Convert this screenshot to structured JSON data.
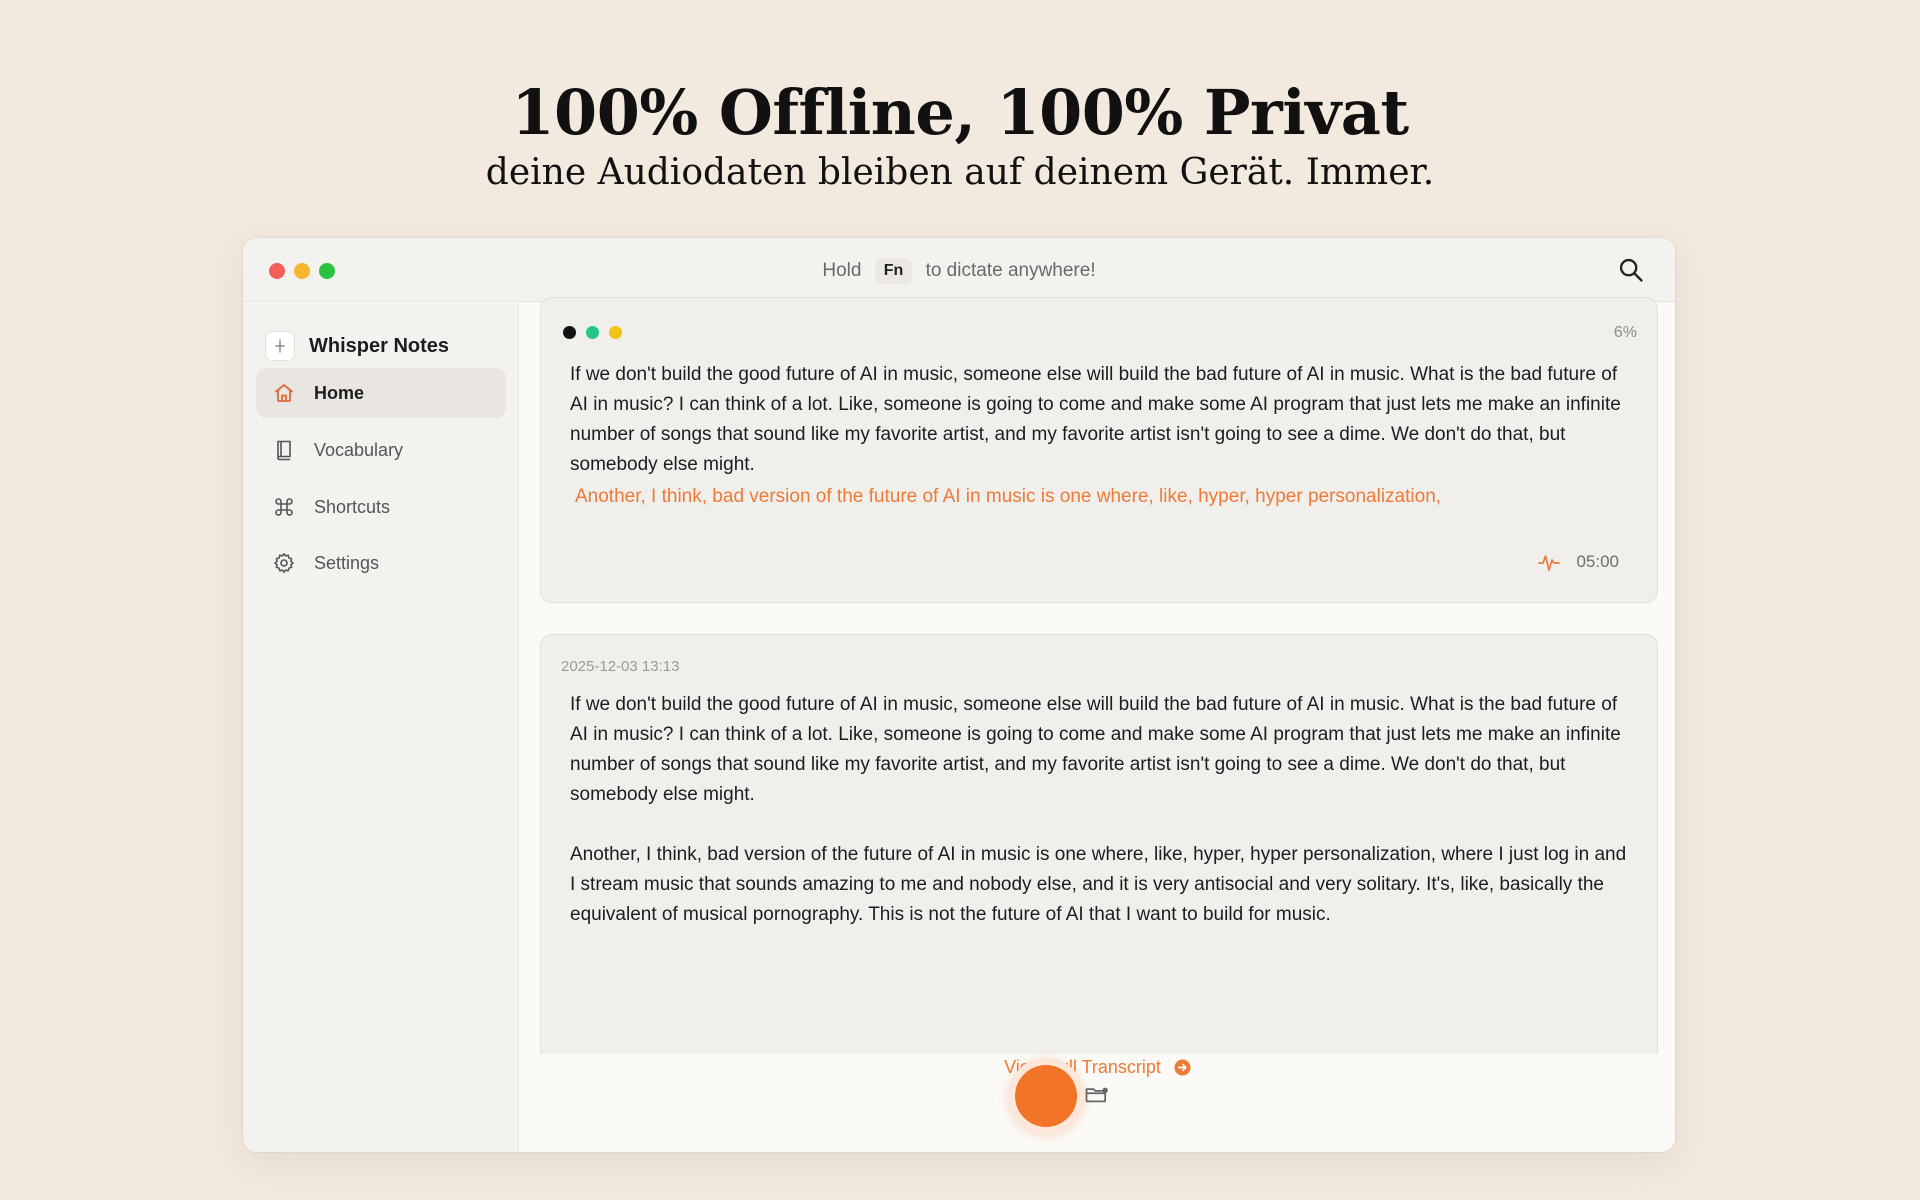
{
  "hero": {
    "title": "100% Offline, 100% Privat",
    "subtitle": "deine Audiodaten bleiben auf deinem Gerät. Immer."
  },
  "titlebar": {
    "hint_prefix": "Hold",
    "hint_key": "Fn",
    "hint_suffix": "to dictate anywhere!",
    "icons": {
      "search": "search-icon"
    }
  },
  "sidebar": {
    "app_name": "Whisper Notes",
    "items": [
      {
        "label": "Home",
        "icon": "home-icon",
        "active": true
      },
      {
        "label": "Vocabulary",
        "icon": "book-icon",
        "active": false
      },
      {
        "label": "Shortcuts",
        "icon": "command-icon",
        "active": false
      },
      {
        "label": "Settings",
        "icon": "gear-icon",
        "active": false
      }
    ]
  },
  "live_card": {
    "progress": "6%",
    "text": "If we don't build the good future of AI in music, someone else will build the bad future of AI in music. What is the bad future of AI in music? I can think of a lot. Like, someone is going to come and make some AI program that just lets me make an infinite number of songs that sound like my favorite artist, and my favorite artist isn't going to see a dime. We don't do that, but somebody else might.",
    "partial_text": "Another, I think, bad version of the future of AI in music is one where, like, hyper, hyper personalization,",
    "duration": "05:00"
  },
  "history_card": {
    "timestamp": "2025-12-03 13:13",
    "paragraph_1": "If we don't build the good future of AI in music, someone else will build the bad future of AI in music.  What is the bad future of AI in music? I can think of a lot.  Like, someone is going to come and make some AI program that just lets me make an infinite number of songs that sound like my favorite artist, and my favorite artist isn't going to see a dime.  We don't do that, but somebody else might.",
    "paragraph_2": "Another, I think, bad version of the future of AI in music is one where, like, hyper, hyper personalization, where I just log in and I stream music that sounds amazing to me and nobody else, and it is very antisocial and very solitary.  It's, like, basically the equivalent of musical pornography.  This is not the future of AI that I want to build for music.",
    "view_full": "View Full Transcript"
  },
  "colors": {
    "accent": "#f27427",
    "accent_text": "#ee7a36",
    "background": "#f3eadf",
    "traffic_red": "#f25f57",
    "traffic_yellow": "#f6b62d",
    "traffic_green": "#29c33f"
  }
}
